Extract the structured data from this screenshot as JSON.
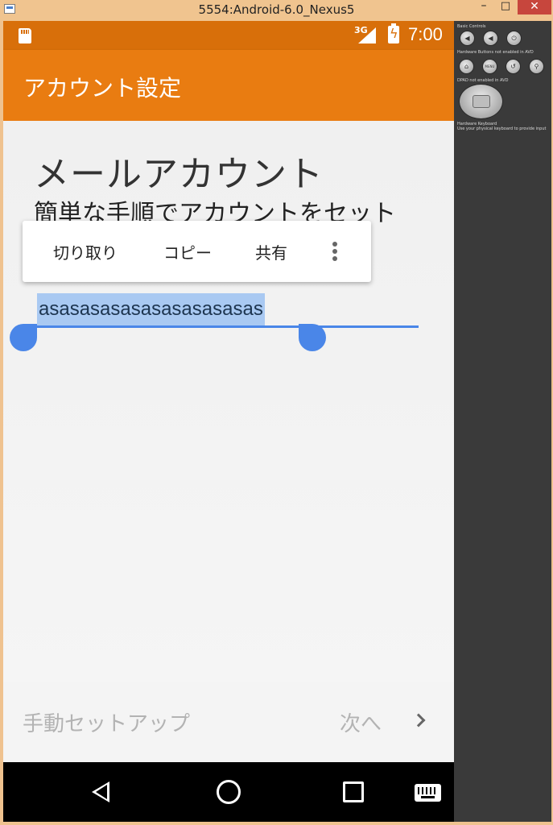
{
  "window": {
    "title": "5554:Android-6.0_Nexus5",
    "minimize": "–",
    "maximize": "□",
    "close": "✕"
  },
  "statusbar": {
    "network": "3G",
    "time": "7:00",
    "icons": [
      "sd-card-icon",
      "signal-icon",
      "battery-charging-icon"
    ]
  },
  "appbar": {
    "title": "アカウント設定"
  },
  "main": {
    "heading": "メールアカウント",
    "subheading": "簡単な手順でアカウントをセット",
    "email_field_value": "asasasasasasasasasasas"
  },
  "context_menu": {
    "cut": "切り取り",
    "copy": "コピー",
    "share": "共有",
    "more_icon": "overflow-menu-icon"
  },
  "bottombar": {
    "manual_setup": "手動セットアップ",
    "next": "次へ"
  },
  "navbar": {
    "icons": [
      "back-icon",
      "home-icon",
      "recents-icon",
      "keyboard-icon"
    ]
  },
  "side_panel": {
    "basic_controls": "Basic Controls",
    "hardware_buttons": "Hardware Buttons not enabled in AVD",
    "dpad": "DPAD not enabled in AVD",
    "hardware_keyboard": "Hardware Keyboard",
    "keyboard_hint": "Use your physical keyboard to provide input",
    "menu_label": "MENU"
  },
  "colors": {
    "statusbar": "#d86f0a",
    "appbar": "#e97c11",
    "selection": "#a9c9f2",
    "accent": "#4a86e8"
  }
}
